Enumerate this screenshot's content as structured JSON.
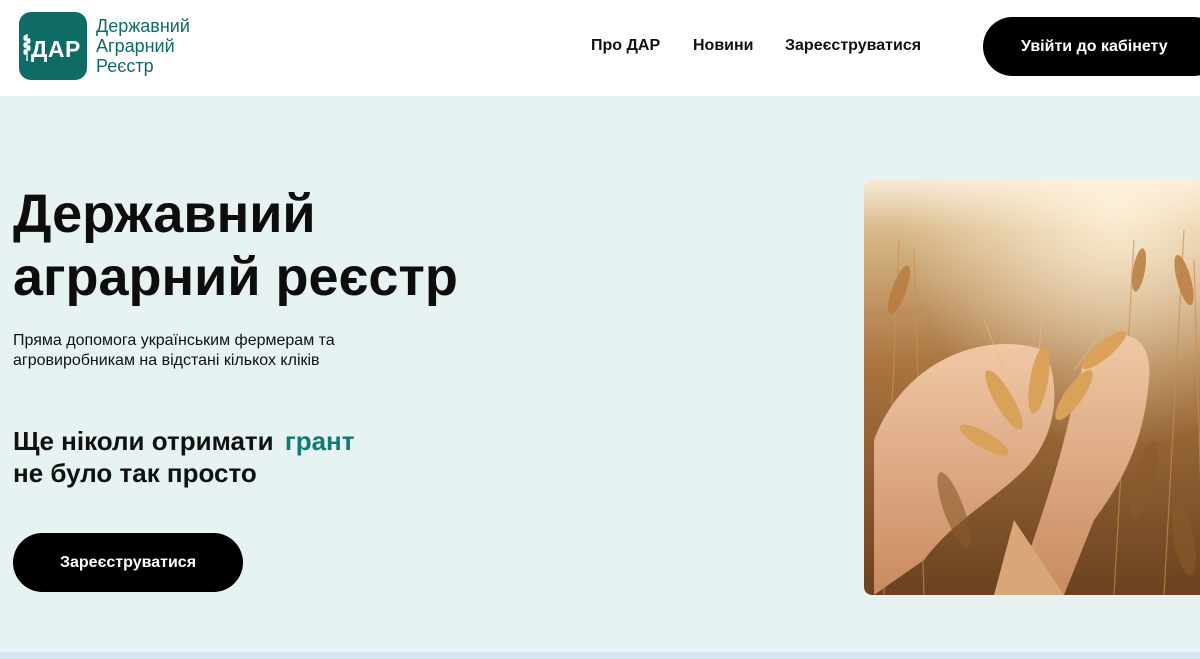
{
  "header": {
    "logo": {
      "abbr": "ДАР",
      "lines": [
        "Державний",
        "Аграрний",
        "Реєстр"
      ]
    },
    "nav": {
      "about": "Про ДАР",
      "news": "Новини",
      "register": "Зареєструватися"
    },
    "login_label": "Увійти до кабінету"
  },
  "hero": {
    "title_lines": [
      "Державний",
      "аграрний реєстр"
    ],
    "subtitle": "Пряма допомога українським фермерам та агровиробникам на відстані кількох кліків",
    "tagline": {
      "part1": "Ще ніколи отримати",
      "accent": "грант",
      "part2": "не було так просто"
    },
    "register_label": "Зареєструватися"
  },
  "icons": {
    "logo_wheat": "wheat-icon"
  },
  "colors": {
    "brand": "#0f6b66",
    "accent": "#0f7a74",
    "hero_bg": "#e6f3f2",
    "button": "#000000"
  }
}
